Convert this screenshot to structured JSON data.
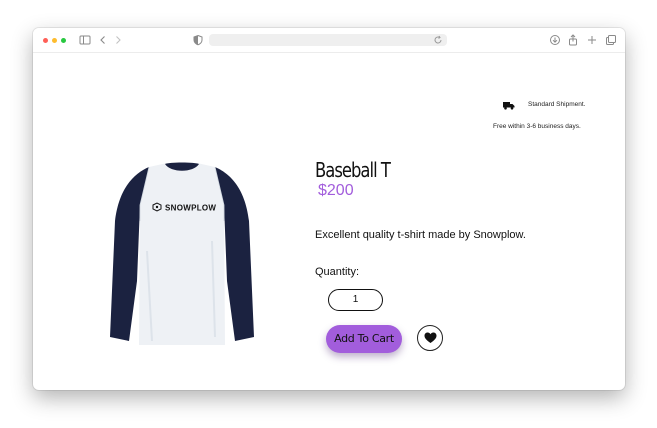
{
  "browser": {
    "traffic_lights": {
      "close": "#ff5f57",
      "minimize": "#febc2e",
      "zoom": "#28c840"
    },
    "icons": [
      "sidebar-icon",
      "back-icon",
      "forward-icon",
      "shield-icon",
      "reload-icon",
      "download-icon",
      "share-icon",
      "new-tab-icon",
      "tabs-icon"
    ],
    "address_value": ""
  },
  "shipping": {
    "icon": "truck-icon",
    "label": "Standard Shipment.",
    "note": "Free within 3-6 business days."
  },
  "product": {
    "image": "long-sleeve-baseball-tshirt",
    "image_print": "SNOWPLOW",
    "title": "Baseball T",
    "price": "$200",
    "description": "Excellent quality t-shirt made by Snowplow.",
    "quantity_label": "Quantity:",
    "quantity_value": "1",
    "add_to_cart_label": "Add To Cart",
    "wishlist_icon": "heart-icon",
    "accent_color": "#a25ddc"
  }
}
